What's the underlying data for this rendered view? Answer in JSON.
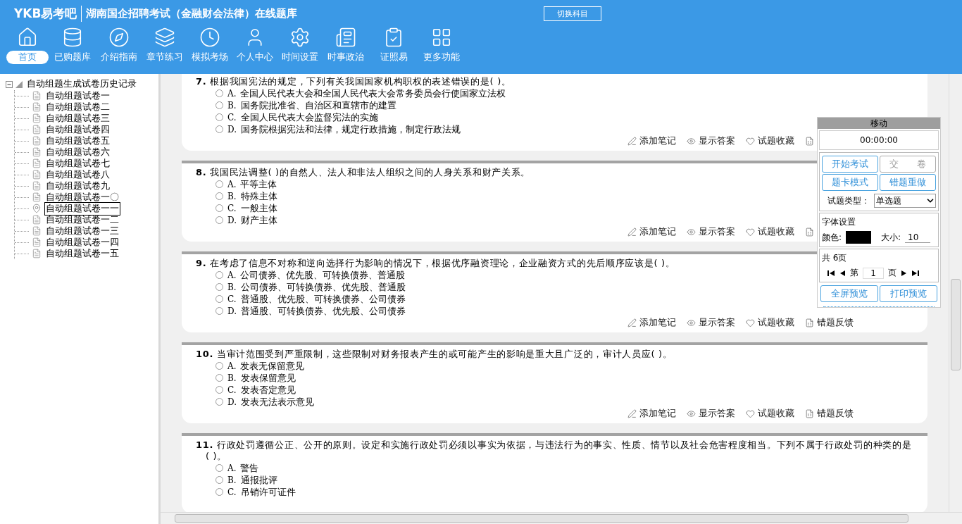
{
  "header": {
    "logo": "YKB易考吧",
    "title": "湖南国企招聘考试（金融财会法律）在线题库",
    "switch_button": "切换科目"
  },
  "toolbar": [
    {
      "label": "首页",
      "selected": true
    },
    {
      "label": "已购题库",
      "selected": false
    },
    {
      "label": "介绍指南",
      "selected": false
    },
    {
      "label": "章节练习",
      "selected": false
    },
    {
      "label": "模拟考场",
      "selected": false
    },
    {
      "label": "个人中心",
      "selected": false
    },
    {
      "label": "时间设置",
      "selected": false
    },
    {
      "label": "时事政治",
      "selected": false
    },
    {
      "label": "证照易",
      "selected": false
    },
    {
      "label": "更多功能",
      "selected": false
    }
  ],
  "tree": {
    "label": "自动组题生成试卷历史记录",
    "expanded": true,
    "children": [
      {
        "label": "自动组题试卷一",
        "selected": false
      },
      {
        "label": "自动组题试卷二",
        "selected": false
      },
      {
        "label": "自动组题试卷三",
        "selected": false
      },
      {
        "label": "自动组题试卷四",
        "selected": false
      },
      {
        "label": "自动组题试卷五",
        "selected": false
      },
      {
        "label": "自动组题试卷六",
        "selected": false
      },
      {
        "label": "自动组题试卷七",
        "selected": false
      },
      {
        "label": "自动组题试卷八",
        "selected": false
      },
      {
        "label": "自动组题试卷九",
        "selected": false
      },
      {
        "label": "自动组题试卷一〇",
        "selected": false
      },
      {
        "label": "自动组题试卷一一",
        "selected": true
      },
      {
        "label": "自动组题试卷一二",
        "selected": false
      },
      {
        "label": "自动组题试卷一三",
        "selected": false
      },
      {
        "label": "自动组题试卷一四",
        "selected": false
      },
      {
        "label": "自动组题试卷一五",
        "selected": false
      }
    ]
  },
  "questions": [
    {
      "number": "7.",
      "text": "根据我国宪法的规定，下列有关我国国家机构职权的表述错误的是( )。",
      "options": [
        {
          "letter": "A.",
          "text": "全国人民代表大会和全国人民代表大会常务委员会行使国家立法权",
          "selected": false
        },
        {
          "letter": "B.",
          "text": "国务院批准省、自治区和直辖市的建置",
          "selected": false
        },
        {
          "letter": "C.",
          "text": "全国人民代表大会监督宪法的实施",
          "selected": false
        },
        {
          "letter": "D.",
          "text": "国务院根据宪法和法律，规定行政措施，制定行政法规",
          "selected": false
        }
      ],
      "actions": [
        {
          "kind": "note",
          "label": "添加笔记"
        },
        {
          "kind": "answer",
          "label": "显示答案"
        },
        {
          "kind": "favorite",
          "label": "试题收藏"
        },
        {
          "kind": "feedback"
        }
      ]
    },
    {
      "number": "8.",
      "text": "我国民法调整( )的自然人、法人和非法人组织之间的人身关系和财产关系。",
      "options": [
        {
          "letter": "A.",
          "text": "平等主体",
          "selected": false
        },
        {
          "letter": "B.",
          "text": "特殊主体",
          "selected": false
        },
        {
          "letter": "C.",
          "text": "一般主体",
          "selected": false
        },
        {
          "letter": "D.",
          "text": "财产主体",
          "selected": false
        }
      ],
      "actions": [
        {
          "kind": "note",
          "label": "添加笔记"
        },
        {
          "kind": "answer",
          "label": "显示答案"
        },
        {
          "kind": "favorite",
          "label": "试题收藏"
        },
        {
          "kind": "feedback"
        }
      ]
    },
    {
      "number": "9.",
      "text": "在考虑了信息不对称和逆向选择行为影响的情况下，根据优序融资理论，企业融资方式的先后顺序应该是( )。",
      "options": [
        {
          "letter": "A.",
          "text": "公司债券、优先股、可转换债券、普通股",
          "selected": false
        },
        {
          "letter": "B.",
          "text": "公司债券、可转换债券、优先股、普通股",
          "selected": false
        },
        {
          "letter": "C.",
          "text": "普通股、优先股、可转换债券、公司债券",
          "selected": false
        },
        {
          "letter": "D.",
          "text": "普通股、可转换债券、优先股、公司债券",
          "selected": false
        }
      ],
      "actions": [
        {
          "kind": "note",
          "label": "添加笔记"
        },
        {
          "kind": "answer",
          "label": "显示答案"
        },
        {
          "kind": "favorite",
          "label": "试题收藏"
        },
        {
          "kind": "feedback",
          "label": "错题反馈"
        }
      ]
    },
    {
      "number": "10.",
      "text": "当审计范围受到严重限制，这些限制对财务报表产生的或可能产生的影响是重大且广泛的，审计人员应( )。",
      "options": [
        {
          "letter": "A.",
          "text": "发表无保留意见",
          "selected": false
        },
        {
          "letter": "B.",
          "text": "发表保留意见",
          "selected": false
        },
        {
          "letter": "C.",
          "text": "发表否定意见",
          "selected": false
        },
        {
          "letter": "D.",
          "text": "发表无法表示意见",
          "selected": false
        }
      ],
      "actions": [
        {
          "kind": "note",
          "label": "添加笔记"
        },
        {
          "kind": "answer",
          "label": "显示答案"
        },
        {
          "kind": "favorite",
          "label": "试题收藏"
        },
        {
          "kind": "feedback",
          "label": "错题反馈"
        }
      ]
    },
    {
      "number": "11.",
      "text": "行政处罚遵循公正、公开的原则。设定和实施行政处罚必须以事实为依据，与违法行为的事实、性质、情节以及社会危害程度相当。下列不属于行政处罚的种类的是( )。",
      "options": [
        {
          "letter": "A.",
          "text": "警告",
          "selected": false
        },
        {
          "letter": "B.",
          "text": "通报批评",
          "selected": false
        },
        {
          "letter": "C.",
          "text": "吊销许可证件",
          "selected": false
        }
      ]
    }
  ],
  "panel": {
    "title": "移动",
    "timer": "00:00:00",
    "buttons": [
      {
        "label": "开始考试",
        "disabled": false
      },
      {
        "label": "交　　卷",
        "disabled": true
      },
      {
        "label": "题卡模式",
        "disabled": false
      },
      {
        "label": "错题重做",
        "disabled": false
      }
    ],
    "type_label": "试题类型：",
    "type_value": "单选题",
    "font_group": "字体设置",
    "color_label": "颜色:",
    "color": "#000000",
    "size_label": "大小:",
    "size_value": "10",
    "page_group": "共 6页",
    "page_prefix": "第",
    "page_value": "1",
    "page_suffix": "页",
    "bottom_buttons": [
      {
        "label": "全屏预览",
        "disabled": false
      },
      {
        "label": "打印预览",
        "disabled": false
      }
    ]
  }
}
